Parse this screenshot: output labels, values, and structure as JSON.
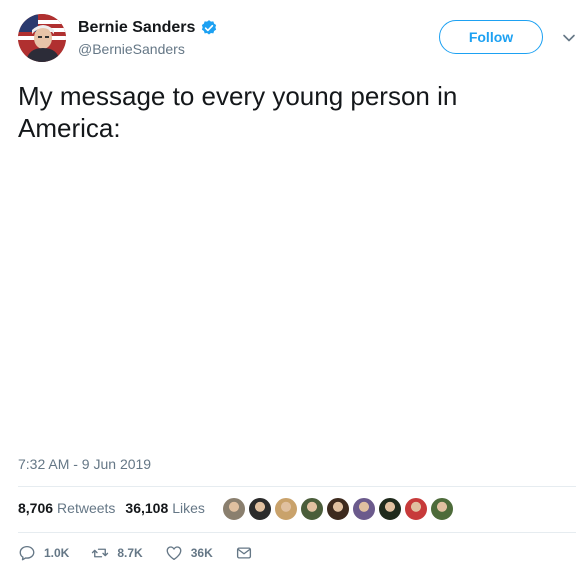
{
  "user": {
    "display_name": "Bernie Sanders",
    "handle": "@BernieSanders",
    "verified": true,
    "avatar_icon": "avatar-photo"
  },
  "follow_label": "Follow",
  "tweet": {
    "text": "My message to every young person in America:",
    "timestamp": "7:32 AM - 9 Jun 2019"
  },
  "stats": {
    "retweets_count": "8,706",
    "retweets_label": "Retweets",
    "likes_count": "36,108",
    "likes_label": "Likes"
  },
  "liker_faces": [
    {
      "color": "#8a7f6e"
    },
    {
      "color": "#2b2b2b"
    },
    {
      "color": "#c9a26b"
    },
    {
      "color": "#4a5d3a"
    },
    {
      "color": "#3d2a1e"
    },
    {
      "color": "#6b5a8c"
    },
    {
      "color": "#1f2a1c"
    },
    {
      "color": "#c73a3a"
    },
    {
      "color": "#4d6b3a"
    }
  ],
  "actions": {
    "reply_count": "1.0K",
    "retweet_count": "8.7K",
    "like_count": "36K"
  },
  "colors": {
    "accent": "#1da1f2",
    "secondary_text": "#657786",
    "divider": "#e6ecf0"
  }
}
